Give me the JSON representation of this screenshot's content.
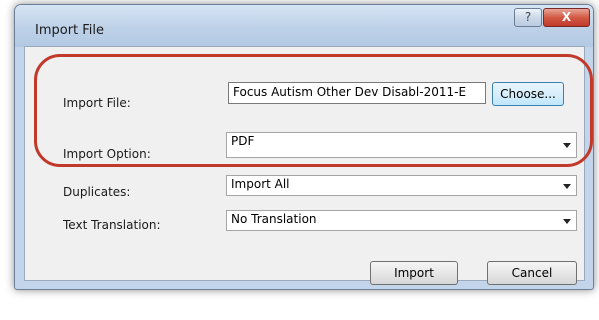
{
  "window": {
    "title": "Import File",
    "help_label": "?",
    "close_label": "X"
  },
  "form": {
    "import_file": {
      "label": "Import File:",
      "value": "Focus Autism Other Dev Disabl-2011-E"
    },
    "choose_button": "Choose...",
    "import_option": {
      "label": "Import Option:",
      "value": "PDF"
    },
    "duplicates": {
      "label": "Duplicates:",
      "value": "Import All"
    },
    "text_translation": {
      "label": "Text Translation:",
      "value": "No Translation"
    }
  },
  "buttons": {
    "import": "Import",
    "cancel": "Cancel"
  },
  "colors": {
    "highlight": "#c0392b",
    "window_frame": "#c3d5ea"
  }
}
